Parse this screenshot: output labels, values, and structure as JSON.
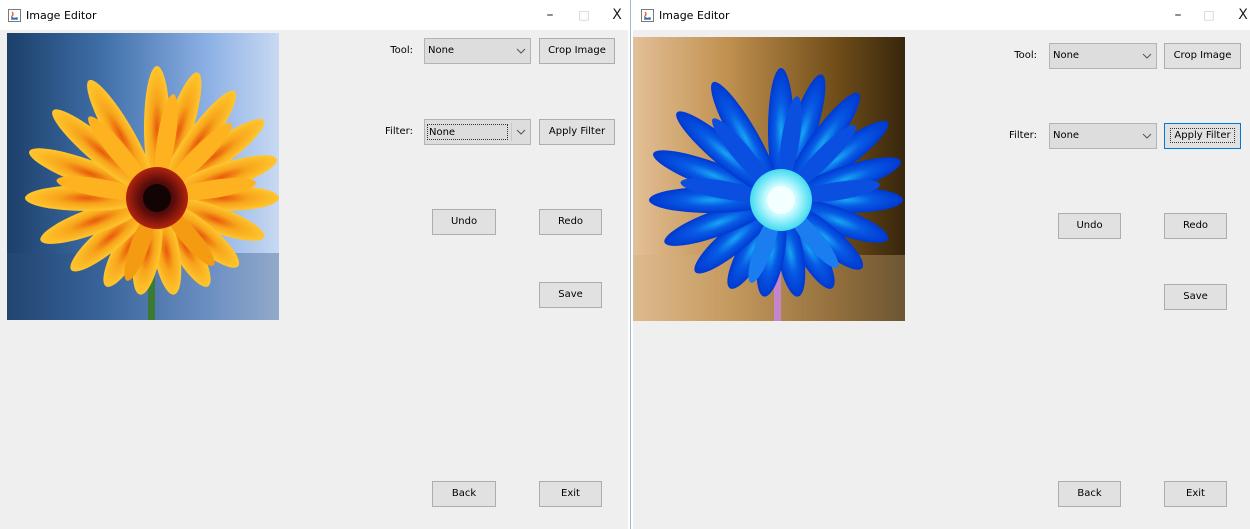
{
  "windows": [
    {
      "title": "Image Editor",
      "controls": {
        "minimize": "–",
        "maximize": "□",
        "close": "X"
      },
      "photo": "orange gerbera daisy",
      "tool_label": "Tool:",
      "tool_value": "None",
      "crop_label": "Crop Image",
      "filter_label": "Filter:",
      "filter_value": "None",
      "apply_label": "Apply Filter",
      "undo_label": "Undo",
      "redo_label": "Redo",
      "save_label": "Save",
      "back_label": "Back",
      "exit_label": "Exit"
    },
    {
      "title": "Image Editor",
      "controls": {
        "minimize": "–",
        "maximize": "□",
        "close": "X"
      },
      "photo": "blue inverted gerbera daisy",
      "tool_label": "Tool:",
      "tool_value": "None",
      "crop_label": "Crop Image",
      "filter_label": "Filter:",
      "filter_value": "None",
      "apply_label": "Apply Filter",
      "undo_label": "Undo",
      "redo_label": "Redo",
      "save_label": "Save",
      "back_label": "Back",
      "exit_label": "Exit"
    }
  ],
  "colors": {
    "window_bg": "#efefef",
    "button_bg": "#e1e1e1",
    "focus_border": "#0078d7"
  }
}
